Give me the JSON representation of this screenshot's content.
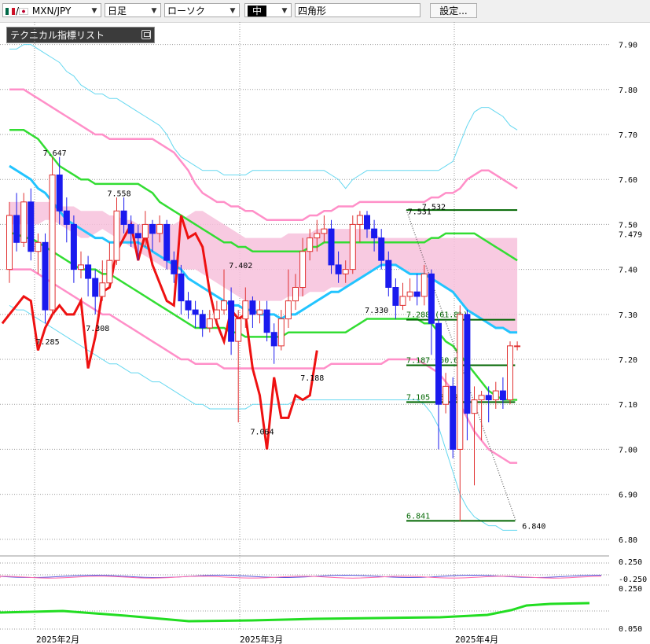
{
  "toolbar": {
    "symbol": "MXN/JPY",
    "period": "日足",
    "chart_style": "ローソク",
    "size": "中",
    "marker": "四角形",
    "settings_label": "設定..."
  },
  "indicator_panel": {
    "title": "テクニカル指標リスト"
  },
  "colors": {
    "up_candle": "#e03030",
    "down_candle": "#1a1aee",
    "ichimoku_cloud": "#f7c1dc",
    "ma_cyan": "#22c4ff",
    "ma_green": "#33dd33",
    "bollinger_1": "#ff8fc8",
    "bollinger_2": "#66d8f0",
    "chikou": "#ee1111",
    "fibo": "#006600"
  },
  "chart_data": {
    "type": "candlestick",
    "symbol": "MXN/JPY",
    "ylim": [
      6.77,
      7.95
    ],
    "y_ticks": [
      "7.90",
      "7.80",
      "7.70",
      "7.60",
      "7.50",
      "7.479",
      "7.40",
      "7.30",
      "7.20",
      "7.10",
      "7.00",
      "6.90",
      "6.80"
    ],
    "current_price": "7.479",
    "x_labels": [
      "2025年2月",
      "2025年3月",
      "2025年4月"
    ],
    "annotations": [
      "7.647",
      "7.558",
      "7.285",
      "7.308",
      "7.402",
      "7.064",
      "7.188",
      "7.330",
      "7.531",
      "7.532",
      "6.840"
    ],
    "fibonacci": [
      {
        "label": "7.288 (61.8%)",
        "value": 7.288
      },
      {
        "label": "7.187 (50.0%)",
        "value": 7.187
      },
      {
        "label": "7.105 (38.2%)",
        "value": 7.105
      },
      {
        "label": "6.841",
        "value": 6.841
      }
    ],
    "fibo_top": 7.532,
    "candles": [
      [
        7.4,
        7.52,
        7.55,
        7.37
      ],
      [
        7.52,
        7.46,
        7.57,
        7.44
      ],
      [
        7.46,
        7.55,
        7.57,
        7.45
      ],
      [
        7.55,
        7.44,
        7.58,
        7.42
      ],
      [
        7.44,
        7.46,
        7.48,
        7.39
      ],
      [
        7.46,
        7.31,
        7.48,
        7.28
      ],
      [
        7.31,
        7.61,
        7.65,
        7.3
      ],
      [
        7.61,
        7.53,
        7.65,
        7.5
      ],
      [
        7.53,
        7.5,
        7.56,
        7.46
      ],
      [
        7.5,
        7.4,
        7.52,
        7.37
      ],
      [
        7.4,
        7.41,
        7.44,
        7.38
      ],
      [
        7.41,
        7.38,
        7.43,
        7.34
      ],
      [
        7.38,
        7.34,
        7.4,
        7.3
      ],
      [
        7.34,
        7.37,
        7.42,
        7.33
      ],
      [
        7.37,
        7.42,
        7.46,
        7.36
      ],
      [
        7.42,
        7.53,
        7.56,
        7.41
      ],
      [
        7.53,
        7.5,
        7.56,
        7.48
      ],
      [
        7.5,
        7.48,
        7.52,
        7.45
      ],
      [
        7.48,
        7.47,
        7.5,
        7.42
      ],
      [
        7.47,
        7.5,
        7.53,
        7.45
      ],
      [
        7.5,
        7.48,
        7.51,
        7.44
      ],
      [
        7.48,
        7.5,
        7.52,
        7.46
      ],
      [
        7.5,
        7.42,
        7.51,
        7.4
      ],
      [
        7.42,
        7.39,
        7.44,
        7.37
      ],
      [
        7.39,
        7.33,
        7.41,
        7.3
      ],
      [
        7.33,
        7.31,
        7.35,
        7.29
      ],
      [
        7.31,
        7.3,
        7.33,
        7.27
      ],
      [
        7.3,
        7.27,
        7.31,
        7.25
      ],
      [
        7.27,
        7.29,
        7.31,
        7.26
      ],
      [
        7.29,
        7.31,
        7.33,
        7.28
      ],
      [
        7.31,
        7.33,
        7.4,
        7.3
      ],
      [
        7.33,
        7.24,
        7.36,
        7.21
      ],
      [
        7.24,
        7.29,
        7.31,
        7.06
      ],
      [
        7.29,
        7.33,
        7.36,
        7.27
      ],
      [
        7.33,
        7.3,
        7.34,
        7.27
      ],
      [
        7.3,
        7.31,
        7.33,
        7.28
      ],
      [
        7.31,
        7.26,
        7.33,
        7.24
      ],
      [
        7.26,
        7.23,
        7.28,
        7.19
      ],
      [
        7.23,
        7.29,
        7.31,
        7.22
      ],
      [
        7.29,
        7.33,
        7.4,
        7.27
      ],
      [
        7.33,
        7.36,
        7.39,
        7.31
      ],
      [
        7.36,
        7.44,
        7.47,
        7.34
      ],
      [
        7.44,
        7.47,
        7.49,
        7.42
      ],
      [
        7.47,
        7.48,
        7.51,
        7.44
      ],
      [
        7.48,
        7.49,
        7.52,
        7.46
      ],
      [
        7.49,
        7.41,
        7.51,
        7.39
      ],
      [
        7.41,
        7.39,
        7.44,
        7.37
      ],
      [
        7.39,
        7.4,
        7.42,
        7.37
      ],
      [
        7.4,
        7.5,
        7.52,
        7.39
      ],
      [
        7.5,
        7.52,
        7.53,
        7.46
      ],
      [
        7.52,
        7.49,
        7.53,
        7.47
      ],
      [
        7.49,
        7.47,
        7.51,
        7.44
      ],
      [
        7.47,
        7.42,
        7.49,
        7.4
      ],
      [
        7.42,
        7.36,
        7.44,
        7.34
      ],
      [
        7.36,
        7.32,
        7.38,
        7.29
      ],
      [
        7.32,
        7.34,
        7.37,
        7.31
      ],
      [
        7.34,
        7.35,
        7.38,
        7.33
      ],
      [
        7.35,
        7.34,
        7.39,
        7.32
      ],
      [
        7.34,
        7.39,
        7.41,
        7.32
      ],
      [
        7.39,
        7.28,
        7.4,
        7.21
      ],
      [
        7.28,
        7.1,
        7.29,
        7.0
      ],
      [
        7.1,
        7.14,
        7.17,
        7.08
      ],
      [
        7.14,
        7.0,
        7.16,
        6.98
      ],
      [
        7.0,
        7.3,
        7.32,
        6.84
      ],
      [
        7.3,
        7.08,
        7.31,
        7.02
      ],
      [
        7.08,
        7.11,
        7.14,
        6.92
      ],
      [
        7.11,
        7.12,
        7.13,
        7.02
      ],
      [
        7.12,
        7.11,
        7.14,
        7.06
      ],
      [
        7.11,
        7.13,
        7.15,
        7.09
      ],
      [
        7.13,
        7.11,
        7.16,
        7.09
      ],
      [
        7.11,
        7.23,
        7.24,
        7.1
      ],
      [
        7.23,
        7.23,
        7.24,
        7.22
      ]
    ],
    "ma_cyan": [
      7.63,
      7.62,
      7.61,
      7.6,
      7.58,
      7.57,
      7.55,
      7.53,
      7.51,
      7.5,
      7.49,
      7.48,
      7.47,
      7.47,
      7.46,
      7.46,
      7.46,
      7.46,
      7.46,
      7.45,
      7.44,
      7.43,
      7.42,
      7.41,
      7.4,
      7.38,
      7.37,
      7.36,
      7.35,
      7.34,
      7.33,
      7.32,
      7.32,
      7.31,
      7.31,
      7.3,
      7.3,
      7.3,
      7.29,
      7.3,
      7.3,
      7.31,
      7.32,
      7.33,
      7.34,
      7.35,
      7.35,
      7.36,
      7.37,
      7.38,
      7.39,
      7.4,
      7.41,
      7.41,
      7.41,
      7.4,
      7.39,
      7.39,
      7.39,
      7.38,
      7.37,
      7.36,
      7.35,
      7.33,
      7.31,
      7.3,
      7.29,
      7.28,
      7.27,
      7.27,
      7.26,
      7.26
    ],
    "ma_green": [
      7.71,
      7.71,
      7.71,
      7.7,
      7.69,
      7.67,
      7.65,
      7.63,
      7.62,
      7.61,
      7.6,
      7.6,
      7.59,
      7.59,
      7.59,
      7.59,
      7.59,
      7.59,
      7.59,
      7.58,
      7.57,
      7.55,
      7.54,
      7.53,
      7.52,
      7.51,
      7.5,
      7.49,
      7.48,
      7.47,
      7.46,
      7.46,
      7.45,
      7.45,
      7.44,
      7.44,
      7.44,
      7.44,
      7.44,
      7.44,
      7.44,
      7.44,
      7.45,
      7.45,
      7.46,
      7.46,
      7.46,
      7.46,
      7.46,
      7.46,
      7.46,
      7.46,
      7.46,
      7.46,
      7.46,
      7.46,
      7.46,
      7.46,
      7.46,
      7.47,
      7.47,
      7.48,
      7.48,
      7.48,
      7.48,
      7.48,
      7.47,
      7.46,
      7.45,
      7.44,
      7.43,
      7.42
    ],
    "ma_green2": [
      7.48,
      7.48,
      7.47,
      7.47,
      7.46,
      7.45,
      7.44,
      7.43,
      7.42,
      7.41,
      7.4,
      7.4,
      7.4,
      7.39,
      7.39,
      7.38,
      7.37,
      7.36,
      7.35,
      7.34,
      7.33,
      7.32,
      7.31,
      7.3,
      7.29,
      7.28,
      7.27,
      7.27,
      7.27,
      7.27,
      7.27,
      7.26,
      7.26,
      7.25,
      7.25,
      7.25,
      7.25,
      7.25,
      7.25,
      7.26,
      7.26,
      7.26,
      7.26,
      7.26,
      7.26,
      7.26,
      7.26,
      7.26,
      7.27,
      7.28,
      7.29,
      7.29,
      7.29,
      7.29,
      7.29,
      7.29,
      7.29,
      7.29,
      7.28,
      7.28,
      7.26,
      7.24,
      7.23,
      7.21,
      7.19,
      7.17,
      7.15,
      7.13,
      7.12,
      7.11,
      7.11,
      7.11
    ],
    "boll_upper1": [
      7.8,
      7.8,
      7.8,
      7.79,
      7.78,
      7.77,
      7.76,
      7.75,
      7.74,
      7.73,
      7.72,
      7.71,
      7.7,
      7.7,
      7.69,
      7.69,
      7.69,
      7.69,
      7.69,
      7.69,
      7.69,
      7.68,
      7.67,
      7.66,
      7.64,
      7.62,
      7.59,
      7.57,
      7.56,
      7.55,
      7.55,
      7.54,
      7.54,
      7.53,
      7.53,
      7.52,
      7.51,
      7.51,
      7.51,
      7.51,
      7.51,
      7.51,
      7.52,
      7.52,
      7.53,
      7.53,
      7.54,
      7.54,
      7.54,
      7.55,
      7.55,
      7.55,
      7.55,
      7.55,
      7.55,
      7.55,
      7.55,
      7.55,
      7.55,
      7.56,
      7.56,
      7.57,
      7.57,
      7.58,
      7.6,
      7.61,
      7.62,
      7.62,
      7.61,
      7.6,
      7.59,
      7.58
    ],
    "boll_lower1": [
      7.4,
      7.4,
      7.4,
      7.4,
      7.39,
      7.38,
      7.37,
      7.36,
      7.35,
      7.34,
      7.33,
      7.32,
      7.31,
      7.3,
      7.3,
      7.29,
      7.28,
      7.27,
      7.26,
      7.25,
      7.24,
      7.23,
      7.22,
      7.21,
      7.2,
      7.2,
      7.19,
      7.19,
      7.19,
      7.19,
      7.18,
      7.18,
      7.18,
      7.18,
      7.18,
      7.18,
      7.18,
      7.18,
      7.18,
      7.18,
      7.18,
      7.18,
      7.18,
      7.18,
      7.18,
      7.19,
      7.19,
      7.19,
      7.19,
      7.19,
      7.19,
      7.19,
      7.19,
      7.2,
      7.2,
      7.2,
      7.2,
      7.2,
      7.19,
      7.18,
      7.17,
      7.15,
      7.13,
      7.1,
      7.07,
      7.04,
      7.02,
      7.0,
      6.99,
      6.98,
      6.97,
      6.97
    ],
    "boll_upper2": [
      7.89,
      7.89,
      7.9,
      7.9,
      7.89,
      7.88,
      7.87,
      7.86,
      7.84,
      7.83,
      7.81,
      7.8,
      7.79,
      7.79,
      7.78,
      7.78,
      7.77,
      7.76,
      7.75,
      7.74,
      7.73,
      7.72,
      7.7,
      7.67,
      7.65,
      7.64,
      7.63,
      7.62,
      7.62,
      7.62,
      7.61,
      7.61,
      7.61,
      7.61,
      7.62,
      7.62,
      7.62,
      7.62,
      7.62,
      7.62,
      7.62,
      7.62,
      7.62,
      7.62,
      7.62,
      7.61,
      7.6,
      7.58,
      7.6,
      7.61,
      7.62,
      7.62,
      7.62,
      7.62,
      7.62,
      7.62,
      7.62,
      7.62,
      7.62,
      7.62,
      7.62,
      7.63,
      7.64,
      7.68,
      7.72,
      7.75,
      7.76,
      7.76,
      7.75,
      7.74,
      7.72,
      7.71
    ],
    "boll_lower2": [
      7.32,
      7.31,
      7.31,
      7.3,
      7.29,
      7.28,
      7.27,
      7.26,
      7.25,
      7.24,
      7.23,
      7.22,
      7.21,
      7.2,
      7.19,
      7.19,
      7.18,
      7.17,
      7.17,
      7.16,
      7.15,
      7.15,
      7.14,
      7.13,
      7.12,
      7.11,
      7.1,
      7.1,
      7.09,
      7.09,
      7.09,
      7.09,
      7.09,
      7.09,
      7.1,
      7.1,
      7.1,
      7.1,
      7.1,
      7.1,
      7.11,
      7.11,
      7.11,
      7.11,
      7.11,
      7.11,
      7.11,
      7.11,
      7.11,
      7.11,
      7.11,
      7.11,
      7.11,
      7.11,
      7.11,
      7.11,
      7.11,
      7.11,
      7.1,
      7.08,
      7.05,
      7.0,
      6.95,
      6.9,
      6.87,
      6.85,
      6.84,
      6.83,
      6.83,
      6.82,
      6.82,
      6.82
    ],
    "cloud_top": [
      7.55,
      7.55,
      7.55,
      7.55,
      7.55,
      7.55,
      7.55,
      7.54,
      7.54,
      7.54,
      7.53,
      7.53,
      7.53,
      7.53,
      7.52,
      7.52,
      7.51,
      7.51,
      7.5,
      7.5,
      7.5,
      7.5,
      7.5,
      7.5,
      7.51,
      7.52,
      7.53,
      7.53,
      7.52,
      7.51,
      7.5,
      7.49,
      7.48,
      7.47,
      7.47,
      7.47,
      7.47,
      7.47,
      7.47,
      7.48,
      7.48,
      7.48,
      7.48,
      7.49,
      7.49,
      7.49,
      7.49,
      7.49,
      7.49,
      7.49,
      7.49,
      7.48,
      7.47,
      7.47,
      7.47,
      7.47,
      7.47,
      7.47,
      7.47,
      7.47,
      7.47,
      7.47,
      7.47,
      7.47,
      7.47,
      7.47,
      7.47,
      7.47,
      7.47,
      7.47,
      7.47,
      7.47
    ],
    "cloud_bottom": [
      7.5,
      7.5,
      7.5,
      7.5,
      7.5,
      7.51,
      7.51,
      7.5,
      7.49,
      7.48,
      7.47,
      7.47,
      7.48,
      7.49,
      7.48,
      7.47,
      7.46,
      7.45,
      7.44,
      7.43,
      7.42,
      7.41,
      7.4,
      7.4,
      7.4,
      7.4,
      7.4,
      7.39,
      7.38,
      7.37,
      7.36,
      7.35,
      7.34,
      7.33,
      7.33,
      7.33,
      7.33,
      7.33,
      7.33,
      7.34,
      7.34,
      7.34,
      7.35,
      7.35,
      7.35,
      7.36,
      7.36,
      7.36,
      7.37,
      7.38,
      7.39,
      7.4,
      7.41,
      7.41,
      7.41,
      7.4,
      7.39,
      7.39,
      7.39,
      7.38,
      7.37,
      7.36,
      7.35,
      7.33,
      7.31,
      7.3,
      7.29,
      7.28,
      7.27,
      7.27,
      7.26,
      7.26
    ],
    "chikou": [
      7.28,
      7.3,
      7.32,
      7.34,
      7.33,
      7.22,
      7.27,
      7.3,
      7.32,
      7.3,
      7.3,
      7.33,
      7.18,
      7.25,
      7.35,
      7.36,
      7.44,
      7.47,
      7.5,
      7.42,
      7.48,
      7.41,
      7.37,
      7.33,
      7.32,
      7.52,
      7.47,
      7.48,
      7.45,
      7.35,
      7.28,
      7.24,
      7.31,
      7.29,
      7.3,
      7.18,
      7.12,
      7.0,
      7.16,
      7.07,
      7.07,
      7.12,
      7.11,
      7.12,
      7.22
    ],
    "sub_osc": {
      "ylim": [
        -0.05,
        0.25
      ],
      "ticks": [
        "0.250",
        "-0.250",
        "0.250",
        "0.050"
      ]
    }
  }
}
